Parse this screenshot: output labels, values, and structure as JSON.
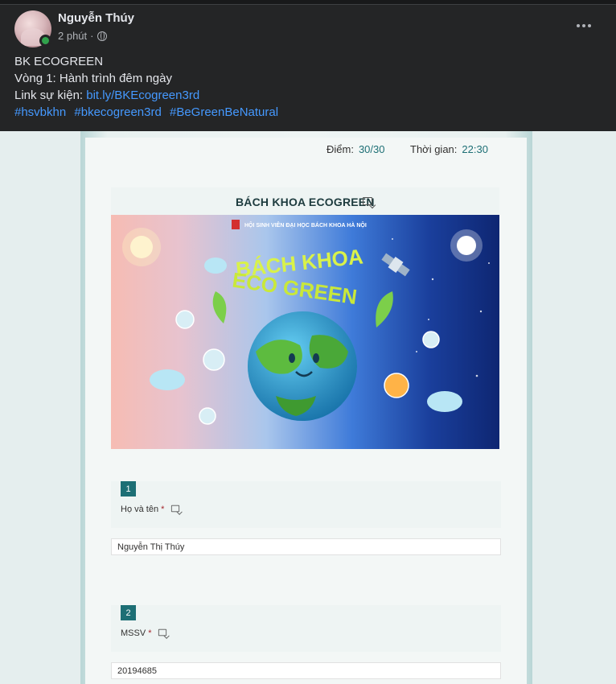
{
  "post": {
    "author": "Nguyễn Thúy",
    "time": "2 phút",
    "meta_separator": "·",
    "lines": [
      "BK ECOGREEN",
      "Vòng 1: Hành trình đêm ngày"
    ],
    "link_prefix": "Link sự kiện: ",
    "link_text": "bit.ly/BKEcogreen3rd",
    "hashtags": [
      "#hsvbkhn",
      "#bkecogreen3rd",
      "#BeGreenBeNatural"
    ]
  },
  "form": {
    "score_label": "Điểm:",
    "score_value": "30/30",
    "time_label": "Thời gian:",
    "time_value": "22:30",
    "title": "BÁCH KHOA ECOGREEN",
    "banner": {
      "org": "HỘI SINH VIÊN ĐẠI HỌC BÁCH KHOA HÀ NỘI",
      "headline_1": "BÁCH KHOA",
      "headline_2": "ECO GREEN"
    },
    "questions": [
      {
        "number": "1",
        "label": "Họ và tên",
        "required": "*",
        "answer": "Nguyễn Thị Thúy"
      },
      {
        "number": "2",
        "label": "MSSV",
        "required": "*",
        "answer": "20194685"
      }
    ]
  },
  "colors": {
    "link": "#4599ff",
    "accent": "#1d6f75",
    "online": "#31a24c"
  }
}
